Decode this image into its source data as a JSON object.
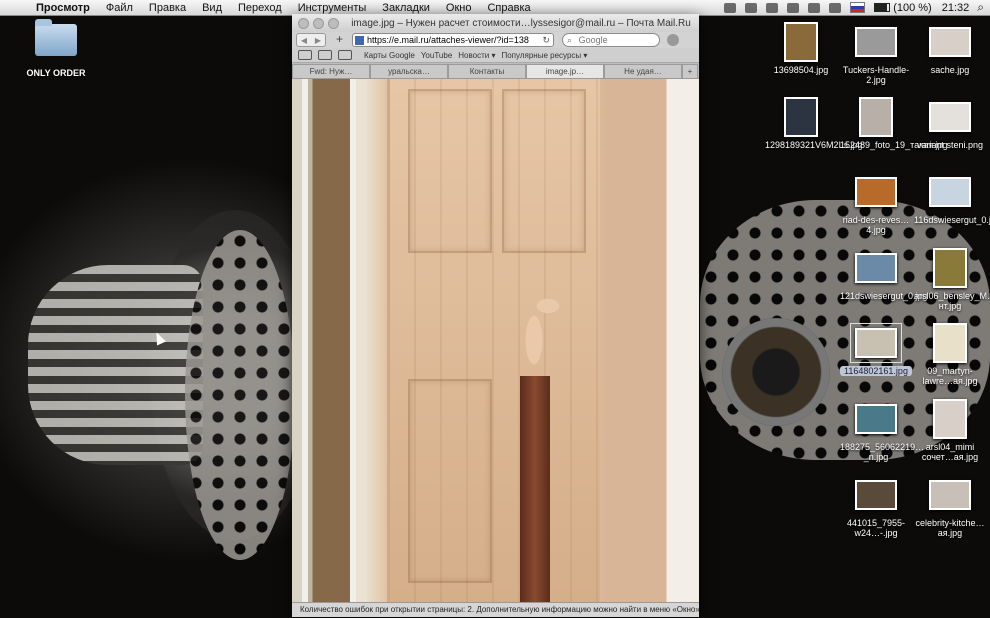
{
  "menubar": {
    "app_name": "Просмотр",
    "items": [
      "Файл",
      "Правка",
      "Вид",
      "Переход",
      "Инструменты",
      "Закладки",
      "Окно",
      "Справка"
    ],
    "battery": "(100 %)",
    "clock": "21:32"
  },
  "desktop": {
    "folder_label": "ONLY ORDER",
    "icons": [
      {
        "label": "13698504.jpg",
        "color": "#8a6a3a"
      },
      {
        "label": "Tuckers-Handle-2.jpg",
        "color": "#9a9a9a"
      },
      {
        "label": "sache.jpg",
        "color": "#d8d0c8"
      },
      {
        "label": "1298189321V6M2Ls.jpg",
        "color": "#2b3440"
      },
      {
        "label": "152489_foto_19_такая.jpg",
        "color": "#b8b0a8"
      },
      {
        "label": "variant steni.png",
        "color": "#e4e0dc"
      },
      {
        "label": "riad-des-reves…4.jpg",
        "color": "#b86a2a"
      },
      {
        "label": "116dswiesergut_0.jpg",
        "color": "#c8d4e0"
      },
      {
        "label": "121dswiesergut_0.jpg",
        "color": "#6a8aa8"
      },
      {
        "label": "arsl06_bensley_M…нт.jpg",
        "color": "#8a7a3a"
      },
      {
        "label": "1164802161.jpg",
        "color": "#c8c0b0"
      },
      {
        "label": "09_martyn-lawre…ая.jpg",
        "color": "#e8e0c8"
      },
      {
        "label": "188275_56062219…_n.jpg",
        "color": "#4a7a8a"
      },
      {
        "label": "arsl04_mimi сочет…ая.jpg",
        "color": "#d8d0c8"
      },
      {
        "label": "441015_7955-w24…-.jpg",
        "color": "#5a4a3a"
      },
      {
        "label": "celebrity-kitche…ая.jpg",
        "color": "#c8c0b8"
      }
    ]
  },
  "browser": {
    "title": "image.jpg – Нужен расчет стоимости…lyssesigor@mail.ru – Почта Mail.Ru",
    "url": "https://e.mail.ru/attaches-viewer/?id=138",
    "search_placeholder": "Google",
    "bookmarks": [
      "Карты Google",
      "YouTube",
      "Новости ▾",
      "Популярные ресурсы ▾"
    ],
    "tabs": [
      "Fwd: Нуж…",
      "уральска…",
      "Контакты",
      "image.jp…",
      "Не удая…"
    ],
    "active_tab": 3,
    "add_tab": "+",
    "status": "Количество ошибок при открытии страницы: 2. Дополнительную информацию можно найти в меню «Окно»"
  }
}
